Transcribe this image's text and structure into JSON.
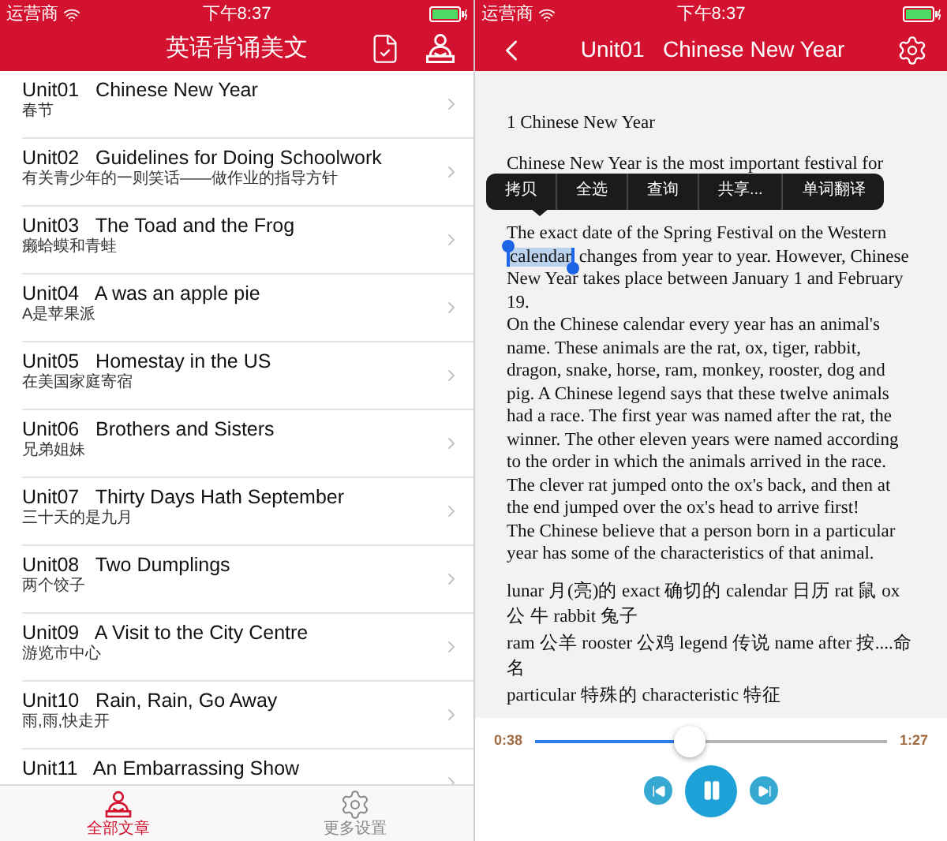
{
  "left": {
    "status_bar": {
      "carrier": "运营商",
      "time": "下午8:37"
    },
    "header": {
      "title": "英语背诵美文"
    },
    "units": [
      {
        "title": "Unit01   Chinese New Year",
        "subtitle": "春节"
      },
      {
        "title": "Unit02   Guidelines for Doing Schoolwork",
        "subtitle": "有关青少年的一则笑话——做作业的指导方针"
      },
      {
        "title": "Unit03   The Toad and the Frog",
        "subtitle": "癞蛤蟆和青蛙"
      },
      {
        "title": "Unit04   A was an apple pie",
        "subtitle": "A是苹果派"
      },
      {
        "title": "Unit05   Homestay in the US",
        "subtitle": "在美国家庭寄宿"
      },
      {
        "title": "Unit06   Brothers and Sisters",
        "subtitle": "兄弟姐妹"
      },
      {
        "title": "Unit07   Thirty Days Hath September",
        "subtitle": "三十天的是九月"
      },
      {
        "title": "Unit08   Two Dumplings",
        "subtitle": "两个饺子"
      },
      {
        "title": "Unit09   A Visit to the City Centre",
        "subtitle": "游览市中心"
      },
      {
        "title": "Unit10   Rain, Rain, Go Away",
        "subtitle": "雨,雨,快走开"
      },
      {
        "title": "Unit11   An Embarrassing Show"
      }
    ],
    "tab_bar": [
      {
        "kind": "articles",
        "label": "全部文章",
        "selected": true
      },
      {
        "kind": "settings",
        "label": "更多设置",
        "selected": false
      }
    ]
  },
  "right": {
    "status_bar": {
      "carrier": "运营商",
      "time": "下午8:37"
    },
    "header": {
      "title": "Unit01   Chinese New Year"
    },
    "heading": "1 Chinese New Year",
    "intro": "Chinese New Year is the most important festival for",
    "context_menu": [
      "拷贝",
      "全选",
      "查询",
      "共享...",
      "单词翻译"
    ],
    "selection_paragraph": {
      "before": "The exact date of the Spring Festival on the Western ",
      "selected": "calendar",
      "after": " changes from year to year. However, Chinese New Year takes place between January 1 and February 19."
    },
    "paragraphs": [
      "On the Chinese calendar every year has an animal's name. These animals are the rat, ox, tiger, rabbit, dragon, snake, horse, ram, monkey, rooster, dog and pig. A Chinese legend says that these twelve animals had a race. The first year was named after the rat, the winner. The other eleven years were named according to the order in which the animals arrived in the race. The clever rat jumped onto the ox's back, and then at the end jumped over the ox's head to arrive first!",
      "The Chinese believe that a person born in a particular year has some of the characteristics of that animal."
    ],
    "vocabulary": [
      "lunar 月(亮)的 exact 确切的 calendar 日历 rat 鼠 ox 公 牛 rabbit 兔子",
      "ram 公羊 rooster 公鸡 legend 传说 name after 按....命名",
      "particular 特殊的 characteristic 特征"
    ],
    "player": {
      "elapsed": "0:38",
      "total": "1:27",
      "level": 0.44,
      "playing": true
    }
  }
}
